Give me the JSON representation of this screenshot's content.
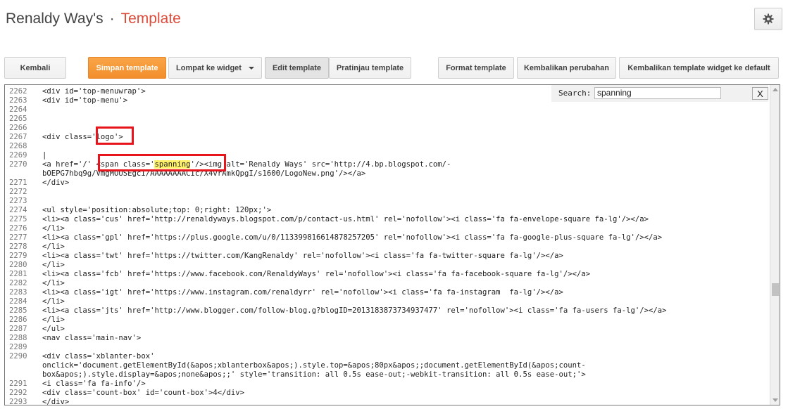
{
  "header": {
    "site_name": "Renaldy Way's",
    "separator": "·",
    "page_title": "Template",
    "settings_icon": "gear-icon"
  },
  "toolbar": {
    "back": "Kembali",
    "save": "Simpan template",
    "jump_to_widget": "Lompat ke widget",
    "edit_template": "Edit template",
    "preview_template": "Pratinjau template",
    "format_template": "Format template",
    "revert_changes": "Kembalikan perubahan",
    "revert_widget_default": "Kembalikan template widget ke default"
  },
  "search": {
    "label": "Search:",
    "value": "spanning",
    "close": "X"
  },
  "editor": {
    "lines": [
      {
        "n": "2262",
        "t": "<div id='top-menuwrap'>"
      },
      {
        "n": "2263",
        "t": "<div id='top-menu'>"
      },
      {
        "n": "2264",
        "t": ""
      },
      {
        "n": "2265",
        "t": ""
      },
      {
        "n": "2266",
        "t": ""
      },
      {
        "n": "2267",
        "t": "<div class='logo'>"
      },
      {
        "n": "2268",
        "t": ""
      },
      {
        "n": "2269",
        "t": "|"
      },
      {
        "n": "2270",
        "t": "<a href='/' <span class='spanning'/><img alt='Renaldy Ways' src='http://4.bp.blogspot.com/-",
        "pre": "<a href='/' <span class='",
        "hl": "spanning",
        "post": "'/><img alt='Renaldy Ways' src='http://4.bp.blogspot.com/-"
      },
      {
        "n": "",
        "t": "bOEPG7hbq9g/VmgMOUSEgcI/AAAAAAAACIc/X4vrAmkQpgI/s1600/LogoNew.png'/></a>"
      },
      {
        "n": "2271",
        "t": "</div>"
      },
      {
        "n": "2272",
        "t": ""
      },
      {
        "n": "2273",
        "t": ""
      },
      {
        "n": "2274",
        "t": "<ul style='position:absolute;top: 0;right: 120px;'>"
      },
      {
        "n": "2275",
        "t": "<li><a class='cus' href='http://renaldyways.blogspot.com/p/contact-us.html' rel='nofollow'><i class='fa fa-envelope-square fa-lg'/></a>"
      },
      {
        "n": "2276",
        "t": "</li>"
      },
      {
        "n": "2277",
        "t": "<li><a class='gpl' href='https://plus.google.com/u/0/113399816614878257205' rel='nofollow'><i class='fa fa-google-plus-square fa-lg'/></a>"
      },
      {
        "n": "2278",
        "t": "</li>"
      },
      {
        "n": "2279",
        "t": "<li><a class='twt' href='https://twitter.com/KangRenaldy' rel='nofollow'><i class='fa fa-twitter-square fa-lg'/></a>"
      },
      {
        "n": "2280",
        "t": "</li>"
      },
      {
        "n": "2281",
        "t": "<li><a class='fcb' href='https://www.facebook.com/RenaldyWays' rel='nofollow'><i class='fa fa-facebook-square fa-lg'/></a>"
      },
      {
        "n": "2282",
        "t": "</li>"
      },
      {
        "n": "2283",
        "t": "<li><a class='igt' href='https://www.instagram.com/renaldyrr' rel='nofollow'><i class='fa fa-instagram  fa-lg'/></a>"
      },
      {
        "n": "2284",
        "t": "</li>"
      },
      {
        "n": "2285",
        "t": "<li><a class='jts' href='http://www.blogger.com/follow-blog.g?blogID=2013183873734937477' rel='nofollow'><i class='fa fa-users fa-lg'/></a>"
      },
      {
        "n": "2286",
        "t": "</li>"
      },
      {
        "n": "2287",
        "t": "</ul>"
      },
      {
        "n": "2288",
        "t": "<nav class='main-nav'>"
      },
      {
        "n": "2289",
        "t": ""
      },
      {
        "n": "2290",
        "t": "<div class='xblanter-box'"
      },
      {
        "n": "",
        "t": "onclick='document.getElementById(&apos;xblanterbox&apos;).style.top=&apos;80px&apos;;document.getElementById(&apos;count-"
      },
      {
        "n": "",
        "t": "box&apos;).style.display=&apos;none&apos;;' style='transition: all 0.5s ease-out;-webkit-transition: all 0.5s ease-out;'>"
      },
      {
        "n": "2291",
        "t": "<i class='fa fa-info'/>"
      },
      {
        "n": "2292",
        "t": "<div class='count-box' id='count-box'>4</div>"
      },
      {
        "n": "2293",
        "t": "</div>"
      }
    ]
  },
  "colors": {
    "accent_orange": "#f28e2b",
    "title_orange": "#dd4b39",
    "highlight_yellow": "#fff06a",
    "annotation_red": "#e8141b"
  }
}
